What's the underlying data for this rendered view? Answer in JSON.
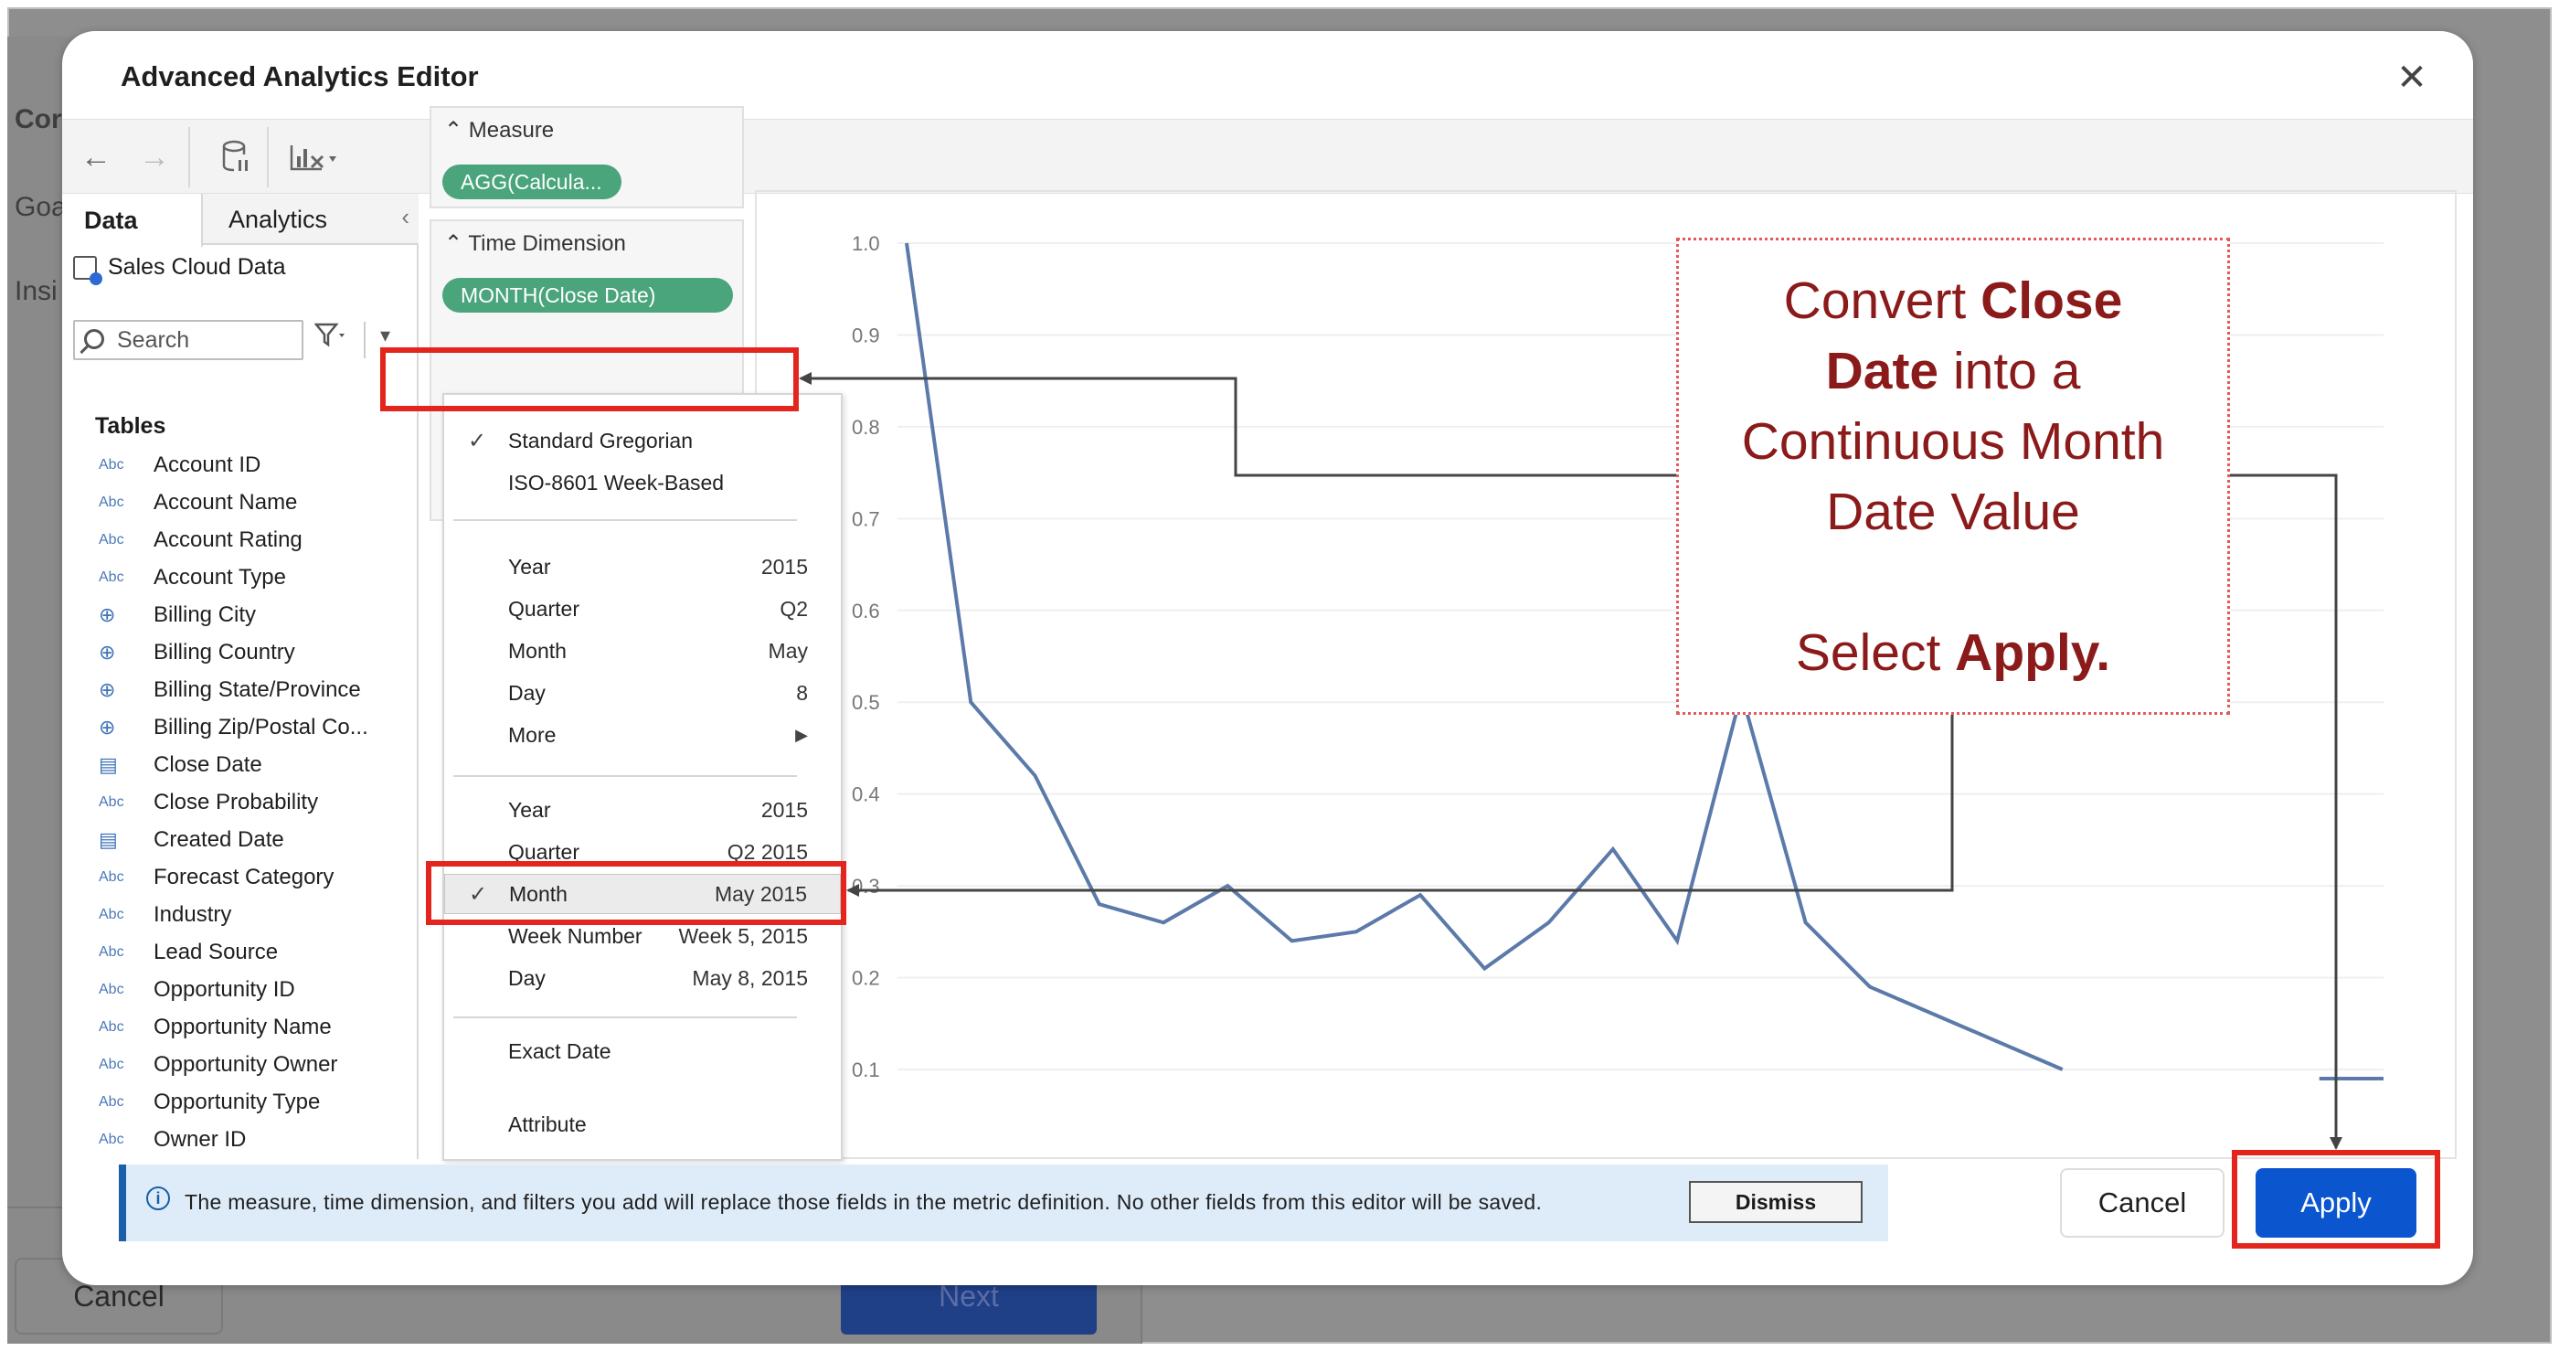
{
  "background": {
    "left_texts": [
      "Cor",
      "Goa",
      "Insi"
    ],
    "cancel_label": "Cancel",
    "next_label": "Next"
  },
  "modal": {
    "title": "Advanced Analytics Editor",
    "close_label": "✕"
  },
  "toolbar": {
    "back": "←",
    "forward": "→"
  },
  "left_pane": {
    "tab_data": "Data",
    "tab_analytics": "Analytics",
    "collapse": "‹",
    "source": "Sales Cloud Data",
    "search_placeholder": "Search",
    "tables_heading": "Tables",
    "fields": [
      {
        "type": "Abc",
        "name": "Account ID"
      },
      {
        "type": "Abc",
        "name": "Account Name"
      },
      {
        "type": "Abc",
        "name": "Account Rating"
      },
      {
        "type": "Abc",
        "name": "Account Type"
      },
      {
        "type": "globe",
        "name": "Billing City"
      },
      {
        "type": "globe",
        "name": "Billing Country"
      },
      {
        "type": "globe",
        "name": "Billing State/Province"
      },
      {
        "type": "globe",
        "name": "Billing Zip/Postal Co..."
      },
      {
        "type": "cal",
        "name": "Close Date"
      },
      {
        "type": "Abc",
        "name": "Close Probability"
      },
      {
        "type": "cal",
        "name": "Created Date"
      },
      {
        "type": "Abc",
        "name": "Forecast Category"
      },
      {
        "type": "Abc",
        "name": "Industry"
      },
      {
        "type": "Abc",
        "name": "Lead Source"
      },
      {
        "type": "Abc",
        "name": "Opportunity ID"
      },
      {
        "type": "Abc",
        "name": "Opportunity Name"
      },
      {
        "type": "Abc",
        "name": "Opportunity Owner"
      },
      {
        "type": "Abc",
        "name": "Opportunity Type"
      },
      {
        "type": "Abc",
        "name": "Owner ID"
      }
    ]
  },
  "shelves": {
    "measure_title": "Measure",
    "measure_pill": "AGG(Calcula...",
    "time_title": "Time Dimension",
    "time_pill": "MONTH(Close Date)"
  },
  "menu": {
    "standard": "Standard Gregorian",
    "iso": "ISO-8601 Week-Based",
    "discrete": [
      {
        "label": "Year",
        "value": "2015"
      },
      {
        "label": "Quarter",
        "value": "Q2"
      },
      {
        "label": "Month",
        "value": "May"
      },
      {
        "label": "Day",
        "value": "8"
      }
    ],
    "more": "More",
    "continuous": [
      {
        "label": "Year",
        "value": "2015"
      },
      {
        "label": "Quarter",
        "value": "Q2 2015"
      },
      {
        "label": "Month",
        "value": "May 2015"
      },
      {
        "label": "Week Number",
        "value": "Week 5, 2015"
      },
      {
        "label": "Day",
        "value": "May 8, 2015"
      }
    ],
    "exact_date": "Exact Date",
    "attribute": "Attribute"
  },
  "chart_data": {
    "type": "line",
    "title": "",
    "xlabel": "",
    "ylabel": "",
    "ylim": [
      0.1,
      1.0
    ],
    "y_ticks": [
      "1.0",
      "0.9",
      "0.8",
      "0.7",
      "0.6",
      "0.5",
      "0.4",
      "0.3",
      "0.2",
      "0.1"
    ],
    "series": [
      {
        "color": "#5b7aa9",
        "values": [
          1.0,
          0.5,
          0.42,
          0.28,
          0.26,
          0.3,
          0.24,
          0.25,
          0.29,
          0.21,
          0.26,
          0.34,
          0.24,
          0.51,
          0.26,
          0.19,
          0.16,
          0.13,
          0.1,
          null,
          null,
          null,
          0.09,
          0.09
        ]
      }
    ],
    "grid": true,
    "legend": "none"
  },
  "info_banner": {
    "text": "The measure, time dimension, and filters you add will replace those fields in the metric definition. No other fields from this editor will be saved.",
    "dismiss": "Dismiss"
  },
  "footer": {
    "cancel": "Cancel",
    "apply": "Apply"
  },
  "annotation": {
    "line1_pre": "Convert ",
    "line1_bold": "Close",
    "line2_bold": "Date",
    "line2_post": " into a",
    "line3": "Continuous Month",
    "line4": "Date Value",
    "line5_pre": "Select ",
    "line5_bold": "Apply.",
    "colors": {
      "text": "#8b1a1a",
      "box": "#e3251e"
    }
  }
}
